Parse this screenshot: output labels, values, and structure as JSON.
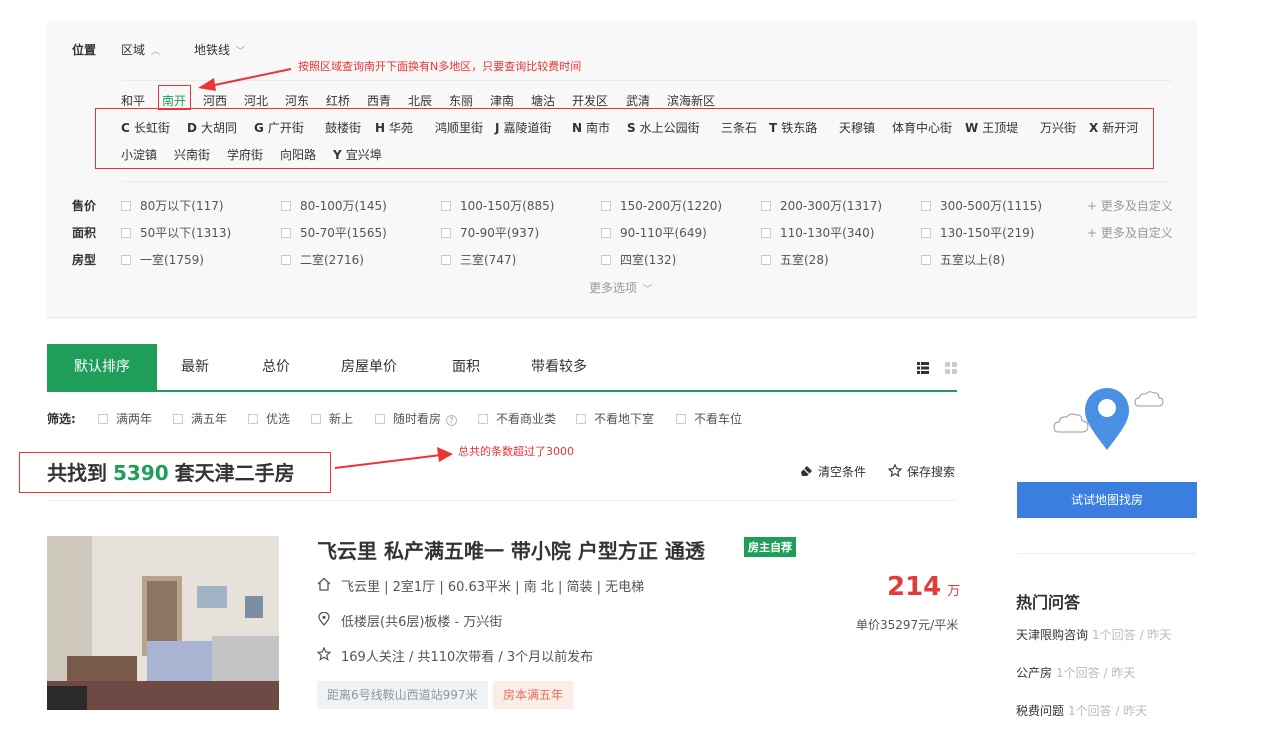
{
  "location": {
    "label": "位置",
    "tabs": [
      {
        "label": "区域"
      },
      {
        "label": "地铁线"
      }
    ],
    "districts": [
      "和平",
      "南开",
      "河西",
      "河北",
      "河东",
      "红桥",
      "西青",
      "北辰",
      "东丽",
      "津南",
      "塘沽",
      "开发区",
      "武清",
      "滨海新区"
    ],
    "active_district": "南开",
    "sub_areas_row1": [
      {
        "letter": "C",
        "name": "长虹街"
      },
      {
        "letter": "D",
        "name": "大胡同"
      },
      {
        "letter": "G",
        "name": "广开街"
      },
      {
        "letter": "",
        "name": "鼓楼街"
      },
      {
        "letter": "H",
        "name": "华苑"
      },
      {
        "letter": "",
        "name": "鸿顺里街"
      },
      {
        "letter": "J",
        "name": "嘉陵道街"
      },
      {
        "letter": "N",
        "name": "南市"
      },
      {
        "letter": "S",
        "name": "水上公园街"
      },
      {
        "letter": "",
        "name": "三条石"
      },
      {
        "letter": "T",
        "name": "铁东路"
      },
      {
        "letter": "",
        "name": "天穆镇"
      },
      {
        "letter": "",
        "name": "体育中心街"
      },
      {
        "letter": "W",
        "name": "王顶堤"
      },
      {
        "letter": "",
        "name": "万兴街"
      },
      {
        "letter": "X",
        "name": "新开河"
      }
    ],
    "sub_areas_row2": [
      {
        "letter": "",
        "name": "小淀镇"
      },
      {
        "letter": "",
        "name": "兴南街"
      },
      {
        "letter": "",
        "name": "学府街"
      },
      {
        "letter": "",
        "name": "向阳路"
      },
      {
        "letter": "Y",
        "name": "宜兴埠"
      }
    ]
  },
  "annotations": {
    "district_note": "按照区域查询南开下面换有N多地区，只要查询比较费时间",
    "count_note": "总共的条数超过了3000"
  },
  "price_filter": {
    "label": "售价",
    "options": [
      "80万以下(117)",
      "80-100万(145)",
      "100-150万(885)",
      "150-200万(1220)",
      "200-300万(1317)",
      "300-500万(1115)"
    ],
    "more": "+ 更多及自定义"
  },
  "area_filter": {
    "label": "面积",
    "options": [
      "50平以下(1313)",
      "50-70平(1565)",
      "70-90平(937)",
      "90-110平(649)",
      "110-130平(340)",
      "130-150平(219)"
    ],
    "more": "+ 更多及自定义"
  },
  "room_filter": {
    "label": "房型",
    "options": [
      "一室(1759)",
      "二室(2716)",
      "三室(747)",
      "四室(132)",
      "五室(28)",
      "五室以上(8)"
    ]
  },
  "more_options": "更多选项",
  "sort_tabs": [
    "默认排序",
    "最新",
    "总价",
    "房屋单价",
    "面积",
    "带看较多"
  ],
  "screen": {
    "label": "筛选:",
    "options": [
      "满两年",
      "满五年",
      "优选",
      "新上",
      "随时看房",
      "不看商业类",
      "不看地下室",
      "不看车位"
    ],
    "help": "?"
  },
  "results": {
    "prefix": "共找到",
    "count": "5390",
    "suffix": "套天津二手房",
    "clear": "清空条件",
    "save": "保存搜索"
  },
  "listing": {
    "title": "飞云里 私产满五唯一 带小院 户型方正 通透",
    "badge": "房主自荐",
    "house_info": "飞云里 | 2室1厅 | 60.63平米 | 南 北 | 简装 | 无电梯",
    "position_info": "低楼层(共6层)板楼 - 万兴街",
    "follow_info": "169人关注 / 共110次带看 / 3个月以前发布",
    "price": "214",
    "price_unit": "万",
    "unit_price": "单价35297元/平米",
    "tags": [
      "距离6号线鞍山西道站997米",
      "房本满五年"
    ]
  },
  "sidebar": {
    "map_button": "试试地图找房",
    "hot_title": "热门问答",
    "qa": [
      {
        "q": "天津限购咨询",
        "meta": "1个回答 / 昨天"
      },
      {
        "q": "公产房",
        "meta": "1个回答 / 昨天"
      },
      {
        "q": "税费问题",
        "meta": "1个回答 / 昨天"
      }
    ]
  },
  "colors": {
    "accent": "#1f9e5a",
    "price": "#e03c3c",
    "annotation": "#ee3333",
    "map_button": "#3a7ee0"
  }
}
